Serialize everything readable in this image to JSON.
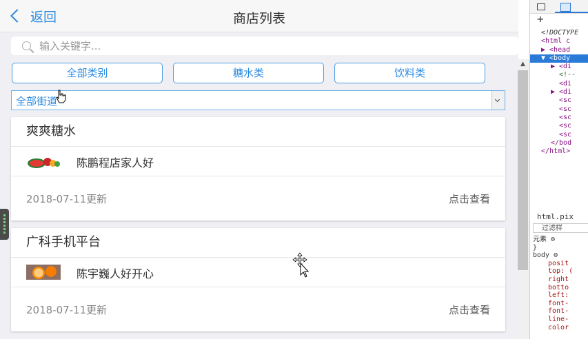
{
  "header": {
    "back_label": "返回",
    "title": "商店列表"
  },
  "search": {
    "placeholder": "输入关键字..."
  },
  "categories": [
    "全部类别",
    "糖水类",
    "饮料类"
  ],
  "street_filter": {
    "selected": "全部街道"
  },
  "shops": [
    {
      "title": "爽爽糖水",
      "shop_name": "陈鹏程店家人好",
      "updated": "2018-07-11更新",
      "action": "点击查看",
      "thumb": "watermelon"
    },
    {
      "title": "广科手机平台",
      "shop_name": "陈宇巍人好开心",
      "updated": "2018-07-11更新",
      "action": "点击查看",
      "thumb": "orange"
    }
  ],
  "devtools": {
    "tree": [
      "<!DOCTYPE",
      "<html c",
      "▶ <head",
      "▼ <body",
      "▶ <di",
      "<!--",
      "<di",
      "▶ <di",
      "<sc",
      "<sc",
      "<sc",
      "<sc",
      "<sc",
      "</bod",
      "</html>"
    ],
    "pane_title": "html.pix",
    "filter_placeholder": "过滤样",
    "styles": [
      "元素 ⚙",
      "}",
      "body ⚙",
      "posit",
      "top: (",
      "right",
      "botto",
      "left:",
      "font-",
      "font-",
      "line-",
      "color"
    ]
  },
  "colors": {
    "accent": "#2a8ae0",
    "background": "#efeff4"
  }
}
